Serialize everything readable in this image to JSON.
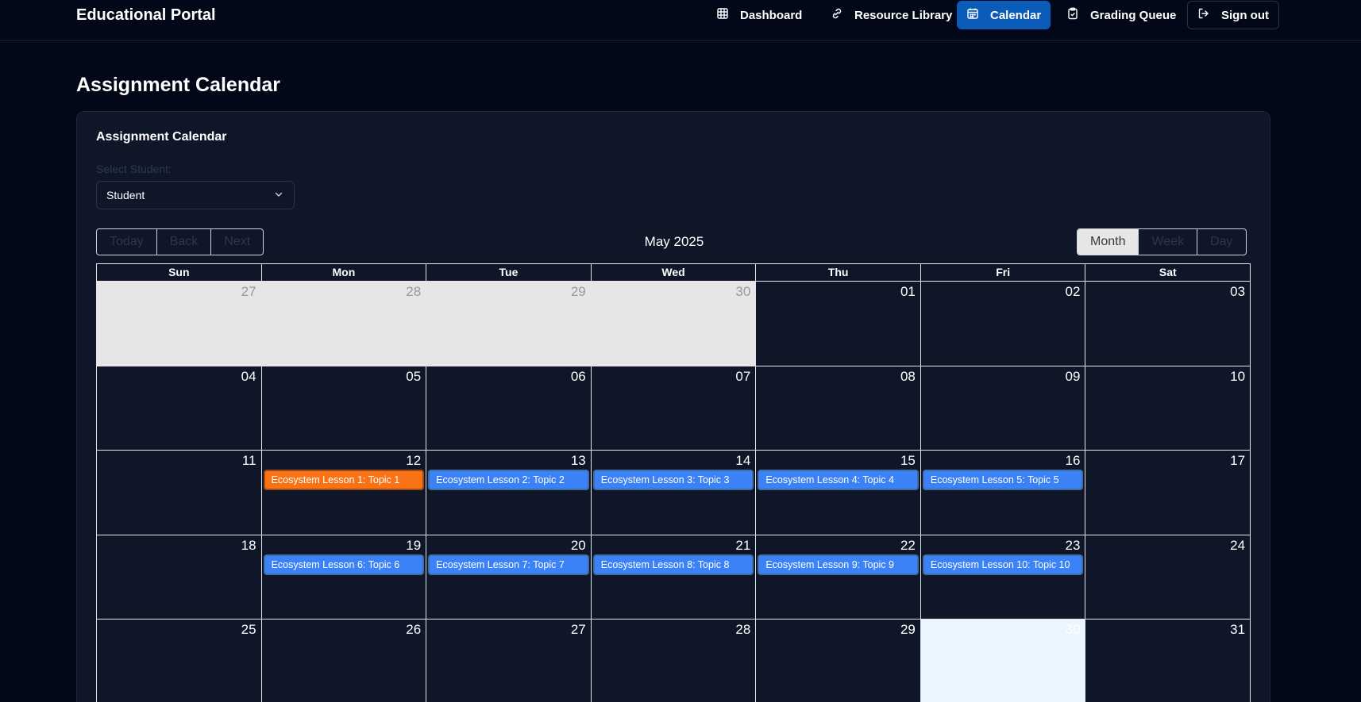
{
  "app": {
    "title": "Educational Portal"
  },
  "nav": {
    "dashboard": "Dashboard",
    "resource_library": "Resource Library",
    "calendar": "Calendar",
    "grading_queue": "Grading Queue",
    "sign_out": "Sign out"
  },
  "page": {
    "title": "Assignment Calendar"
  },
  "card": {
    "title": "Assignment Calendar",
    "select_label": "Select Student:",
    "select_value": "Student"
  },
  "toolbar": {
    "today": "Today",
    "back": "Back",
    "next": "Next",
    "label": "May 2025",
    "views": {
      "month": "Month",
      "week": "Week",
      "day": "Day"
    },
    "active_view": "Month"
  },
  "calendar": {
    "weekdays": [
      "Sun",
      "Mon",
      "Tue",
      "Wed",
      "Thu",
      "Fri",
      "Sat"
    ],
    "weeks": [
      [
        {
          "n": "27",
          "off": true
        },
        {
          "n": "28",
          "off": true
        },
        {
          "n": "29",
          "off": true
        },
        {
          "n": "30",
          "off": true
        },
        {
          "n": "01"
        },
        {
          "n": "02"
        },
        {
          "n": "03"
        }
      ],
      [
        {
          "n": "04"
        },
        {
          "n": "05"
        },
        {
          "n": "06"
        },
        {
          "n": "07"
        },
        {
          "n": "08"
        },
        {
          "n": "09"
        },
        {
          "n": "10"
        }
      ],
      [
        {
          "n": "11"
        },
        {
          "n": "12",
          "event": "Ecosystem Lesson 1: Topic 1",
          "event_color": "#f97316"
        },
        {
          "n": "13",
          "event": "Ecosystem Lesson 2: Topic 2",
          "event_color": "#3b82f6"
        },
        {
          "n": "14",
          "event": "Ecosystem Lesson 3: Topic 3",
          "event_color": "#3b82f6"
        },
        {
          "n": "15",
          "event": "Ecosystem Lesson 4: Topic 4",
          "event_color": "#3b82f6"
        },
        {
          "n": "16",
          "event": "Ecosystem Lesson 5: Topic 5",
          "event_color": "#3b82f6"
        },
        {
          "n": "17"
        }
      ],
      [
        {
          "n": "18"
        },
        {
          "n": "19",
          "event": "Ecosystem Lesson 6: Topic 6",
          "event_color": "#3b82f6"
        },
        {
          "n": "20",
          "event": "Ecosystem Lesson 7: Topic 7",
          "event_color": "#3b82f6"
        },
        {
          "n": "21",
          "event": "Ecosystem Lesson 8: Topic 8",
          "event_color": "#3b82f6"
        },
        {
          "n": "22",
          "event": "Ecosystem Lesson 9: Topic 9",
          "event_color": "#3b82f6"
        },
        {
          "n": "23",
          "event": "Ecosystem Lesson 10: Topic 10",
          "event_color": "#3b82f6"
        },
        {
          "n": "24"
        }
      ],
      [
        {
          "n": "25"
        },
        {
          "n": "26"
        },
        {
          "n": "27"
        },
        {
          "n": "28"
        },
        {
          "n": "29"
        },
        {
          "n": "30",
          "today": true
        },
        {
          "n": "31"
        }
      ]
    ]
  },
  "colors": {
    "accent": "#0b5cb8",
    "event_default": "#3b82f6",
    "event_highlight": "#f97316",
    "today_bg": "#eaf6ff",
    "off_range_bg": "#e6e6e6"
  }
}
